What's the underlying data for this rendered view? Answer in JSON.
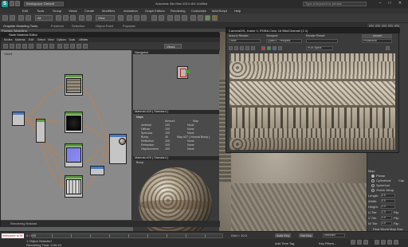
{
  "app": {
    "logo": "S",
    "workspace": "Workspace: Default",
    "window_title": "Autodesk 3ds Max 2014 x64   Untitled",
    "search_placeholder": "Type a keyword or phrase",
    "controls": [
      "–",
      "□",
      "✕"
    ]
  },
  "menubar": [
    "Edit",
    "Tools",
    "Group",
    "Views",
    "Create",
    "Modifiers",
    "Animation",
    "Graph Editors",
    "Rendering",
    "Customize",
    "MAXScript",
    "Help"
  ],
  "toolbar": {
    "filter_select": "All",
    "view_select": "View"
  },
  "ribbon": {
    "tabs": [
      "Graphite Modeling Tools",
      "Freeform",
      "Selection",
      "Object Paint",
      "Populate"
    ],
    "subtab": "Polygon Modeling"
  },
  "slate": {
    "title": "Slate Material Editor",
    "menu": [
      "Modes",
      "Material",
      "Edit",
      "Select",
      "View",
      "Options",
      "Tools",
      "Utilities"
    ],
    "view_label": "View1",
    "navigator_label": "Navigator",
    "navigator_view": "View1",
    "props_title": "Material #25  ( Standard )",
    "props_rollout": "Maps",
    "props_header": [
      "Amount",
      "Map"
    ],
    "props_rows": [
      {
        "name": "Ambient",
        "amount": "100",
        "map": "None"
      },
      {
        "name": "Diffuse",
        "amount": "100",
        "map": "None"
      },
      {
        "name": "Specular",
        "amount": "100",
        "map": "None"
      },
      {
        "name": "Bump",
        "amount": "30",
        "map": "Map #27 ( Normal Bump )"
      },
      {
        "name": "Reflection",
        "amount": "100",
        "map": "None"
      },
      {
        "name": "Refraction",
        "amount": "100",
        "map": "None"
      },
      {
        "name": "Displacement",
        "amount": "100",
        "map": "None"
      }
    ],
    "preview_title": "Material #25  ( Standard )",
    "preview_rollout": "Bump",
    "preview_footer": "Material #25  ( Standard )",
    "status": "Rendering finished"
  },
  "render_frame": {
    "title": "Camera001, frame 0, RGBA Color 16 Bits/Channel (1:1)",
    "area_label": "Area to Render:",
    "area_value": "View",
    "viewport_label": "Viewport:",
    "viewport_value": "Quad 4 - Perspect",
    "preset_label": "Render Preset:",
    "preset_value": "",
    "render_btn": "Render",
    "production_value": "Production",
    "channel_value": "RGB Alpha"
  },
  "command_panel": {
    "rows": [
      "Map:",
      "Planar",
      "Cylindrical",
      "Cap",
      "Spherical",
      "Shrink Wrap",
      "Box",
      "Face",
      "XYZ to UVW",
      "Length:",
      "Width:",
      "Height:",
      "U Tile:",
      "V Tile:",
      "W Tile:",
      "Flip",
      "Real-World Map Size"
    ],
    "values": {
      "length": "0.5",
      "width": "0.5",
      "height": "1.0",
      "u_tile": "1.0",
      "v_tile": "1.0",
      "w_tile": "1.0"
    }
  },
  "bottom": {
    "maxscript": "Welcome to M",
    "selected": "1 Object Selected",
    "render_time": "Rendering Time: 0:00:19",
    "timeline_pos": "0 / 100",
    "grid": "Grid = 10.0",
    "auto_key": "Auto Key",
    "set_key": "Set Key",
    "key_filter": "Selected",
    "add_time_tag": "Add Time Tag",
    "key_filters_btn": "Key Filters..."
  }
}
